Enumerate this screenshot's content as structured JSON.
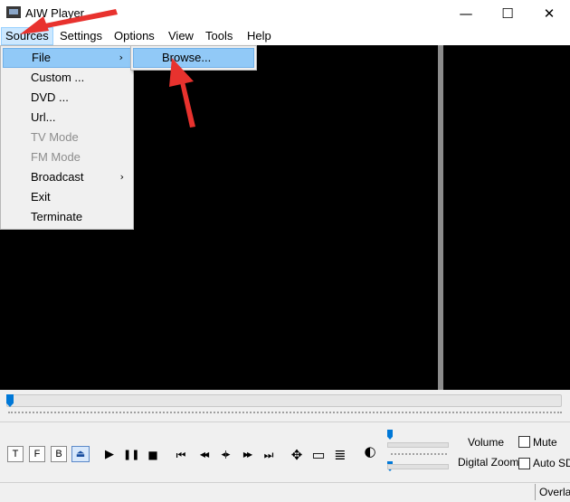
{
  "window": {
    "title": "AIW Player",
    "minimize": "—",
    "maximize": "☐",
    "close": "✕"
  },
  "menubar": [
    "Sources",
    "Settings",
    "Options",
    "View",
    "Tools",
    "Help"
  ],
  "sources_menu": {
    "items": [
      {
        "label": "File",
        "submenu": true,
        "highlighted": true,
        "disabled": false
      },
      {
        "label": "Custom ...",
        "submenu": false,
        "disabled": false
      },
      {
        "label": "DVD ...",
        "submenu": false,
        "disabled": false
      },
      {
        "label": "Url...",
        "submenu": false,
        "disabled": false
      },
      {
        "label": "TV Mode",
        "submenu": false,
        "disabled": true
      },
      {
        "label": "FM Mode",
        "submenu": false,
        "disabled": true
      },
      {
        "label": "Broadcast",
        "submenu": true,
        "disabled": false
      },
      {
        "label": "Exit",
        "submenu": false,
        "disabled": false
      },
      {
        "label": "Terminate",
        "submenu": false,
        "disabled": false
      }
    ],
    "submenu_arrow": "›"
  },
  "file_submenu": {
    "items": [
      {
        "label": "Browse...",
        "highlighted": true
      }
    ]
  },
  "controls": {
    "tfb_buttons": [
      "T",
      "F",
      "B"
    ],
    "eject_glyph": "⏏",
    "transport": {
      "play": "▶",
      "pause": "❚❚",
      "stop": "■",
      "prev": "⏮",
      "rewind": "◀◀",
      "frame_step": "◂|▸",
      "forward": "▶▶",
      "next": "⏭",
      "fullscreen": "✥",
      "monitor": "▭",
      "playlist": "≣",
      "brightness": "◐"
    },
    "volume_label": "Volume",
    "zoom_label": "Digital Zoom",
    "mute_label": "Mute",
    "autosd_label": "Auto SD",
    "seek_position": 0.0,
    "volume_position": 0.0,
    "zoom_position": 0.0
  },
  "status": {
    "text": "Overla"
  },
  "colors": {
    "video_bg": "#000000",
    "highlight": "#91c9f7",
    "menu_bg": "#f0f0f0",
    "accent": "#0078d7",
    "annotation": "#e8322e"
  }
}
